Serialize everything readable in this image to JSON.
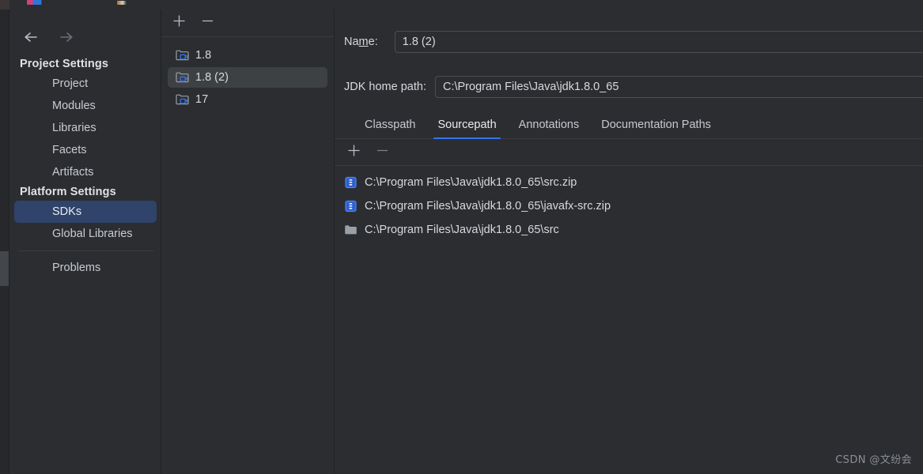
{
  "window": {
    "background_color": "#2b2d30",
    "accent_color": "#3574f0",
    "selection_color": "#2f436b"
  },
  "navigation": {
    "back_icon": "arrow-left-icon",
    "forward_icon": "arrow-right-icon"
  },
  "sidebar": {
    "groups": [
      {
        "label": "Project Settings",
        "items": [
          {
            "label": "Project",
            "selected": false
          },
          {
            "label": "Modules",
            "selected": false
          },
          {
            "label": "Libraries",
            "selected": false
          },
          {
            "label": "Facets",
            "selected": false
          },
          {
            "label": "Artifacts",
            "selected": false
          }
        ]
      },
      {
        "label": "Platform Settings",
        "items": [
          {
            "label": "SDKs",
            "selected": true
          },
          {
            "label": "Global Libraries",
            "selected": false
          }
        ]
      }
    ],
    "footer_items": [
      {
        "label": "Problems",
        "selected": false
      }
    ]
  },
  "sdk_list": {
    "toolbar": {
      "add_label": "+",
      "add_icon": "plus-icon",
      "remove_label": "−",
      "remove_icon": "minus-icon"
    },
    "items": [
      {
        "label": "1.8",
        "icon": "jdk-folder-icon",
        "selected": false
      },
      {
        "label": "1.8 (2)",
        "icon": "jdk-folder-icon",
        "selected": true
      },
      {
        "label": "17",
        "icon": "jdk-folder-icon",
        "selected": false
      }
    ]
  },
  "detail": {
    "name_label_pre": "Na",
    "name_label_mnemonic": "m",
    "name_label_post": "e:",
    "name_value": "1.8 (2)",
    "jdk_home_label": "JDK home path:",
    "jdk_home_value": "C:\\Program Files\\Java\\jdk1.8.0_65",
    "tabs": [
      {
        "label": "Classpath",
        "active": false
      },
      {
        "label": "Sourcepath",
        "active": true
      },
      {
        "label": "Annotations",
        "active": false
      },
      {
        "label": "Documentation Paths",
        "active": false
      }
    ],
    "path_toolbar": {
      "add_label": "+",
      "add_icon": "plus-icon",
      "remove_label": "−",
      "remove_icon": "minus-icon"
    },
    "paths": [
      {
        "value": "C:\\Program Files\\Java\\jdk1.8.0_65\\src.zip",
        "icon": "archive-icon"
      },
      {
        "value": "C:\\Program Files\\Java\\jdk1.8.0_65\\javafx-src.zip",
        "icon": "archive-icon"
      },
      {
        "value": "C:\\Program Files\\Java\\jdk1.8.0_65\\src",
        "icon": "folder-icon"
      }
    ]
  },
  "watermark": {
    "text": "CSDN @文纷会"
  }
}
